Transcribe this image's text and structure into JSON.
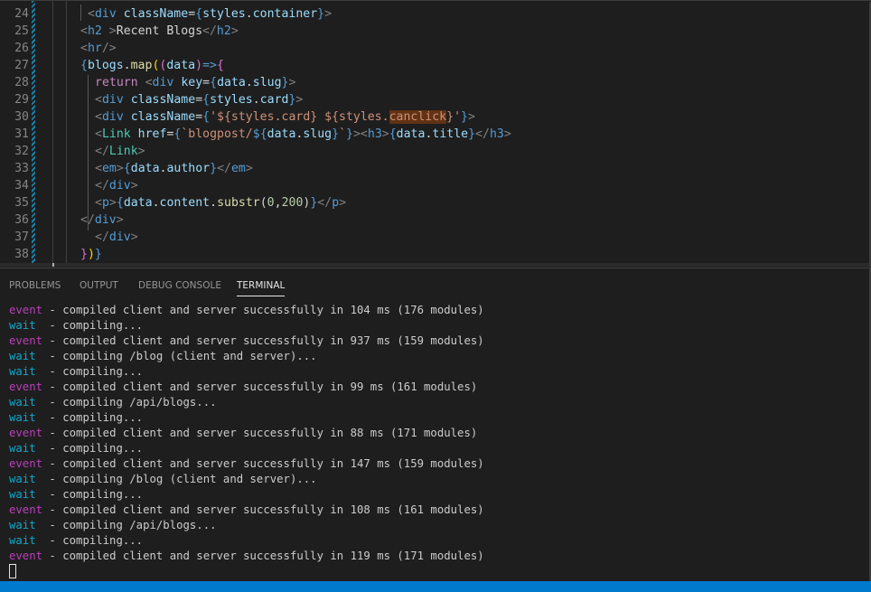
{
  "editor": {
    "lines": [
      {
        "number": "24",
        "indent": 12,
        "tokens": [
          [
            "t-punc",
            "<"
          ],
          [
            "t-tag",
            "div"
          ],
          [
            "t-text",
            " "
          ],
          [
            "t-attr",
            "className"
          ],
          [
            "t-text",
            "="
          ],
          [
            "t-brace",
            "{"
          ],
          [
            "t-var",
            "styles"
          ],
          [
            "t-text",
            "."
          ],
          [
            "t-var",
            "container"
          ],
          [
            "t-brace",
            "}"
          ],
          [
            "t-punc",
            ">"
          ]
        ]
      },
      {
        "number": "25",
        "indent": 11,
        "tokens": [
          [
            "t-punc",
            "<"
          ],
          [
            "t-tag",
            "h2"
          ],
          [
            "t-text",
            " "
          ],
          [
            "t-punc",
            ">"
          ],
          [
            "t-text",
            "Recent Blogs"
          ],
          [
            "t-punc",
            "</"
          ],
          [
            "t-tag",
            "h2"
          ],
          [
            "t-punc",
            ">"
          ]
        ]
      },
      {
        "number": "26",
        "indent": 11,
        "tokens": [
          [
            "t-punc",
            "<"
          ],
          [
            "t-tag",
            "hr"
          ],
          [
            "t-punc",
            "/>"
          ]
        ]
      },
      {
        "number": "27",
        "indent": 11,
        "tokens": [
          [
            "t-brace",
            "{"
          ],
          [
            "t-var",
            "blogs"
          ],
          [
            "t-text",
            "."
          ],
          [
            "t-fn",
            "map"
          ],
          [
            "t-brace3",
            "("
          ],
          [
            "t-brace2",
            "("
          ],
          [
            "t-var",
            "data"
          ],
          [
            "t-brace2",
            ")"
          ],
          [
            "t-tag",
            "=>"
          ],
          [
            "t-brace2",
            "{"
          ]
        ]
      },
      {
        "number": "28",
        "indent": 13,
        "tokens": [
          [
            "t-kw",
            "return"
          ],
          [
            "t-text",
            " "
          ],
          [
            "t-punc",
            "<"
          ],
          [
            "t-tag",
            "div"
          ],
          [
            "t-text",
            " "
          ],
          [
            "t-attr",
            "key"
          ],
          [
            "t-text",
            "="
          ],
          [
            "t-brace",
            "{"
          ],
          [
            "t-var",
            "data"
          ],
          [
            "t-text",
            "."
          ],
          [
            "t-var",
            "slug"
          ],
          [
            "t-brace",
            "}"
          ],
          [
            "t-punc",
            ">"
          ]
        ]
      },
      {
        "number": "29",
        "indent": 13,
        "tokens": [
          [
            "t-punc",
            "<"
          ],
          [
            "t-tag",
            "div"
          ],
          [
            "t-text",
            " "
          ],
          [
            "t-attr",
            "className"
          ],
          [
            "t-text",
            "="
          ],
          [
            "t-brace",
            "{"
          ],
          [
            "t-var",
            "styles"
          ],
          [
            "t-text",
            "."
          ],
          [
            "t-var",
            "card"
          ],
          [
            "t-brace",
            "}"
          ],
          [
            "t-punc",
            ">"
          ]
        ]
      },
      {
        "number": "30",
        "indent": 13,
        "tokens": [
          [
            "t-punc",
            "<"
          ],
          [
            "t-tag",
            "div"
          ],
          [
            "t-text",
            " "
          ],
          [
            "t-attr",
            "className"
          ],
          [
            "t-text",
            "="
          ],
          [
            "t-brace",
            "{"
          ],
          [
            "t-str",
            "'${styles.card} ${styles."
          ],
          [
            "t-str t-hl",
            "canclick"
          ],
          [
            "t-str",
            "}'"
          ],
          [
            "t-brace",
            "}"
          ],
          [
            "t-punc",
            ">"
          ]
        ]
      },
      {
        "number": "31",
        "indent": 13,
        "tokens": [
          [
            "t-punc",
            "<"
          ],
          [
            "t-comp",
            "Link"
          ],
          [
            "t-text",
            " "
          ],
          [
            "t-attr",
            "href"
          ],
          [
            "t-text",
            "="
          ],
          [
            "t-brace",
            "{"
          ],
          [
            "t-str",
            "`blogpost/"
          ],
          [
            "t-tag",
            "${"
          ],
          [
            "t-var",
            "data"
          ],
          [
            "t-text",
            "."
          ],
          [
            "t-var",
            "slug"
          ],
          [
            "t-tag",
            "}"
          ],
          [
            "t-str",
            "`"
          ],
          [
            "t-brace",
            "}"
          ],
          [
            "t-punc",
            "><"
          ],
          [
            "t-tag",
            "h3"
          ],
          [
            "t-punc",
            ">"
          ],
          [
            "t-brace",
            "{"
          ],
          [
            "t-var",
            "data"
          ],
          [
            "t-text",
            "."
          ],
          [
            "t-var",
            "title"
          ],
          [
            "t-brace",
            "}"
          ],
          [
            "t-punc",
            "</"
          ],
          [
            "t-tag",
            "h3"
          ],
          [
            "t-punc",
            ">"
          ]
        ]
      },
      {
        "number": "32",
        "indent": 13,
        "tokens": [
          [
            "t-punc",
            "</"
          ],
          [
            "t-comp",
            "Link"
          ],
          [
            "t-punc",
            ">"
          ]
        ]
      },
      {
        "number": "33",
        "indent": 13,
        "tokens": [
          [
            "t-punc",
            "<"
          ],
          [
            "t-tag",
            "em"
          ],
          [
            "t-punc",
            ">"
          ],
          [
            "t-brace",
            "{"
          ],
          [
            "t-var",
            "data"
          ],
          [
            "t-text",
            "."
          ],
          [
            "t-var",
            "author"
          ],
          [
            "t-brace",
            "}"
          ],
          [
            "t-punc",
            "</"
          ],
          [
            "t-tag",
            "em"
          ],
          [
            "t-punc",
            ">"
          ]
        ]
      },
      {
        "number": "34",
        "indent": 13,
        "tokens": [
          [
            "t-punc",
            "</"
          ],
          [
            "t-tag",
            "div"
          ],
          [
            "t-punc",
            ">"
          ]
        ]
      },
      {
        "number": "35",
        "indent": 13,
        "tokens": [
          [
            "t-punc",
            "<"
          ],
          [
            "t-tag",
            "p"
          ],
          [
            "t-punc",
            ">"
          ],
          [
            "t-brace",
            "{"
          ],
          [
            "t-var",
            "data"
          ],
          [
            "t-text",
            "."
          ],
          [
            "t-var",
            "content"
          ],
          [
            "t-text",
            "."
          ],
          [
            "t-fn",
            "substr"
          ],
          [
            "t-text",
            "("
          ],
          [
            "t-num",
            "0"
          ],
          [
            "t-text",
            ","
          ],
          [
            "t-num",
            "200"
          ],
          [
            "t-text",
            ")"
          ],
          [
            "t-brace",
            "}"
          ],
          [
            "t-punc",
            "</"
          ],
          [
            "t-tag",
            "p"
          ],
          [
            "t-punc",
            ">"
          ]
        ]
      },
      {
        "number": "36",
        "indent": 11,
        "tokens": [
          [
            "t-punc",
            "</"
          ],
          [
            "t-tag",
            "div"
          ],
          [
            "t-punc",
            ">"
          ]
        ]
      },
      {
        "number": "37",
        "indent": 13,
        "tokens": [
          [
            "t-punc",
            "</"
          ],
          [
            "t-tag",
            "div"
          ],
          [
            "t-punc",
            ">"
          ]
        ]
      },
      {
        "number": "38",
        "indent": 11,
        "tokens": [
          [
            "t-brace2",
            "}"
          ],
          [
            "t-brace3",
            ")"
          ],
          [
            "t-brace",
            "}"
          ]
        ]
      }
    ]
  },
  "panel": {
    "tabs": [
      {
        "label": "PROBLEMS",
        "active": false
      },
      {
        "label": "OUTPUT",
        "active": false
      },
      {
        "label": "DEBUG CONSOLE",
        "active": false
      },
      {
        "label": "TERMINAL",
        "active": true
      }
    ]
  },
  "terminal": {
    "lines": [
      {
        "level": "event",
        "message": " - compiled client and server successfully in 104 ms (176 modules)"
      },
      {
        "level": "wait",
        "message": "  - compiling..."
      },
      {
        "level": "event",
        "message": " - compiled client and server successfully in 937 ms (159 modules)"
      },
      {
        "level": "wait",
        "message": "  - compiling /blog (client and server)..."
      },
      {
        "level": "wait",
        "message": "  - compiling..."
      },
      {
        "level": "event",
        "message": " - compiled client and server successfully in 99 ms (161 modules)"
      },
      {
        "level": "wait",
        "message": "  - compiling /api/blogs..."
      },
      {
        "level": "wait",
        "message": "  - compiling..."
      },
      {
        "level": "event",
        "message": " - compiled client and server successfully in 88 ms (171 modules)"
      },
      {
        "level": "wait",
        "message": "  - compiling..."
      },
      {
        "level": "event",
        "message": " - compiled client and server successfully in 147 ms (159 modules)"
      },
      {
        "level": "wait",
        "message": "  - compiling /blog (client and server)..."
      },
      {
        "level": "wait",
        "message": "  - compiling..."
      },
      {
        "level": "event",
        "message": " - compiled client and server successfully in 108 ms (161 modules)"
      },
      {
        "level": "wait",
        "message": "  - compiling /api/blogs..."
      },
      {
        "level": "wait",
        "message": "  - compiling..."
      },
      {
        "level": "event",
        "message": " - compiled client and server successfully in 119 ms (171 modules)"
      }
    ]
  },
  "colors": {
    "status_bar": "#007acc",
    "event": "#bc3fbc",
    "wait": "#11a8cd"
  }
}
